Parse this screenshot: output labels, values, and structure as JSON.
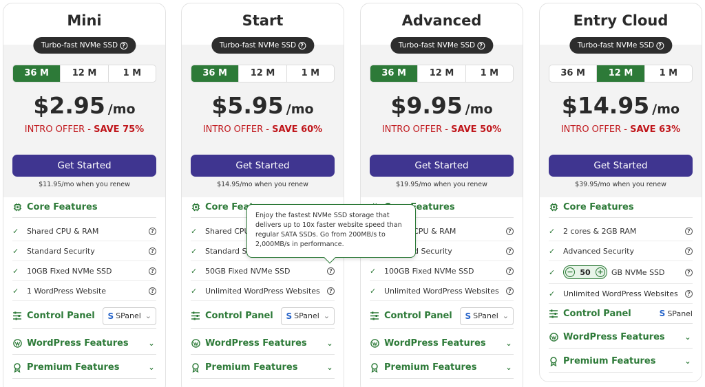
{
  "plans": [
    {
      "name": "Mini",
      "badge": "Turbo-fast NVMe SSD",
      "terms": [
        "36 M",
        "12 M",
        "1 M"
      ],
      "active_term": 0,
      "price": "$2.95",
      "per": "/mo",
      "offer_prefix": "INTRO OFFER - ",
      "offer_save": "SAVE 75%",
      "cta": "Get Started",
      "renew": "$11.95/mo when you renew",
      "core_title": "Core Features",
      "features": [
        "Shared CPU & RAM",
        "Standard Security",
        "10GB Fixed NVMe SSD",
        "1 WordPress Website"
      ],
      "control_panel": "Control Panel",
      "panel_value": "SPanel",
      "wordpress": "WordPress Features",
      "premium": "Premium Features"
    },
    {
      "name": "Start",
      "badge": "Turbo-fast NVMe SSD",
      "terms": [
        "36 M",
        "12 M",
        "1 M"
      ],
      "active_term": 0,
      "price": "$5.95",
      "per": "/mo",
      "offer_prefix": "INTRO OFFER - ",
      "offer_save": "SAVE 60%",
      "cta": "Get Started",
      "renew": "$14.95/mo when you renew",
      "core_title": "Core Features",
      "features": [
        "Shared CPU & RAM",
        "Standard Security",
        "50GB Fixed NVMe SSD",
        "Unlimited WordPress Websites"
      ],
      "control_panel": "Control Panel",
      "panel_value": "SPanel",
      "wordpress": "WordPress Features",
      "premium": "Premium Features"
    },
    {
      "name": "Advanced",
      "badge": "Turbo-fast NVMe SSD",
      "terms": [
        "36 M",
        "12 M",
        "1 M"
      ],
      "active_term": 0,
      "price": "$9.95",
      "per": "/mo",
      "offer_prefix": "INTRO OFFER - ",
      "offer_save": "SAVE 50%",
      "cta": "Get Started",
      "renew": "$19.95/mo when you renew",
      "core_title": "Core Features",
      "features": [
        "Shared CPU & RAM",
        "Standard Security",
        "100GB Fixed NVMe SSD",
        "Unlimited WordPress Websites"
      ],
      "control_panel": "Control Panel",
      "panel_value": "SPanel",
      "wordpress": "WordPress Features",
      "premium": "Premium Features"
    },
    {
      "name": "Entry Cloud",
      "badge": "Turbo-fast NVMe SSD",
      "terms": [
        "36 M",
        "12 M",
        "1 M"
      ],
      "active_term": 1,
      "price": "$14.95",
      "per": "/mo",
      "offer_prefix": "INTRO OFFER - ",
      "offer_save": "SAVE 63%",
      "cta": "Get Started",
      "renew": "$39.95/mo when you renew",
      "core_title": "Core Features",
      "features": [
        "2 cores & 2GB RAM",
        "Advanced Security",
        "GB NVMe SSD",
        "Unlimited WordPress Websites"
      ],
      "storage_value": "50",
      "control_panel": "Control Panel",
      "panel_value": "SPanel",
      "wordpress": "WordPress Features",
      "premium": "Premium Features"
    }
  ],
  "tooltip": {
    "text": "Enjoy the fastest NVMe SSD storage that delivers up to 10x faster website speed than regular SATA SSDs. Go from 200MB/s to 2,000MB/s in performance."
  },
  "icons": {
    "help": "question-circle-icon",
    "check": "check-icon",
    "chip": "cpu-chip-icon",
    "sliders": "sliders-icon",
    "wordpress": "wordpress-icon",
    "award": "award-icon",
    "chevron": "chevron-down-icon"
  },
  "colors": {
    "green": "#2d7a38",
    "purple": "#3f3590",
    "red": "#c0161b",
    "badge": "#2d2d2d"
  }
}
